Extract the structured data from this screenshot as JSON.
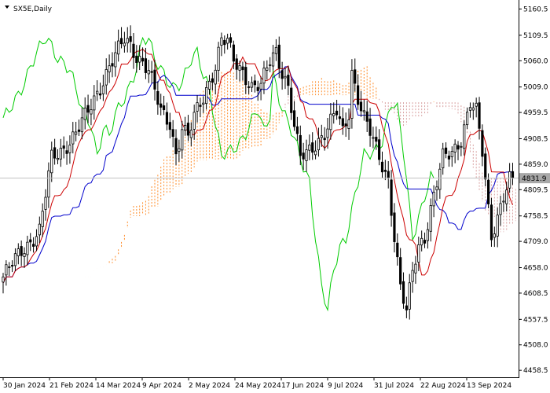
{
  "chart_data": {
    "type": "candlestick",
    "symbol_label": "SX5E,Daily",
    "current_price_label": "4831.9",
    "current_price": 4831.9,
    "ylim": [
      4445,
      5178
    ],
    "y_ticks": [
      "5160.5",
      "5109.5",
      "5060.0",
      "5009.0",
      "4959.5",
      "4908.5",
      "4859.0",
      "4809.5",
      "4758.5",
      "4709.0",
      "4658.0",
      "4608.5",
      "4557.5",
      "4508.0",
      "4458.5"
    ],
    "x_labels": [
      "30 Jan 2024",
      "21 Feb 2024",
      "14 Mar 2024",
      "9 Apr 2024",
      "2 May 2024",
      "24 May 2024",
      "17 Jun 2024",
      "9 Jul 2024",
      "31 Jul 2024",
      "22 Aug 2024",
      "13 Sep 2024"
    ],
    "grid": false,
    "colors": {
      "candle": "#000000",
      "tenkan": "#cc0000",
      "kijun": "#0000cc",
      "chikou": "#00cc00",
      "senkou_a": "#ff8c28",
      "senkou_b": "#d8a0a0",
      "price_line": "#c0c0c0"
    },
    "close_anchors": [
      [
        0,
        4640
      ],
      [
        6,
        4690
      ],
      [
        12,
        4730
      ],
      [
        16,
        4870
      ],
      [
        20,
        4890
      ],
      [
        24,
        4920
      ],
      [
        28,
        4960
      ],
      [
        32,
        5010
      ],
      [
        35,
        5050
      ],
      [
        38,
        5080
      ],
      [
        40,
        5100
      ],
      [
        42,
        5090
      ],
      [
        44,
        5070
      ],
      [
        46,
        5060
      ],
      [
        48,
        5040
      ],
      [
        50,
        5000
      ],
      [
        52,
        4960
      ],
      [
        55,
        4940
      ],
      [
        57,
        4880
      ],
      [
        59,
        4930
      ],
      [
        61,
        4910
      ],
      [
        63,
        4950
      ],
      [
        66,
        4990
      ],
      [
        70,
        5050
      ],
      [
        72,
        5100
      ],
      [
        74,
        5095
      ],
      [
        76,
        5060
      ],
      [
        79,
        5040
      ],
      [
        82,
        5010
      ],
      [
        85,
        5010
      ],
      [
        88,
        5060
      ],
      [
        90,
        5080
      ],
      [
        92,
        5040
      ],
      [
        94,
        5010
      ],
      [
        96,
        4930
      ],
      [
        98,
        4870
      ],
      [
        100,
        4880
      ],
      [
        103,
        4900
      ],
      [
        106,
        4920
      ],
      [
        108,
        4940
      ],
      [
        110,
        4960
      ],
      [
        112,
        4920
      ],
      [
        114,
        4960
      ],
      [
        115,
        5040
      ],
      [
        117,
        4990
      ],
      [
        119,
        4950
      ],
      [
        121,
        4920
      ],
      [
        124,
        4870
      ],
      [
        127,
        4830
      ],
      [
        129,
        4720
      ],
      [
        131,
        4620
      ],
      [
        133,
        4570
      ],
      [
        135,
        4650
      ],
      [
        137,
        4700
      ],
      [
        139,
        4720
      ],
      [
        142,
        4800
      ],
      [
        145,
        4870
      ],
      [
        148,
        4880
      ],
      [
        151,
        4910
      ],
      [
        154,
        4980
      ],
      [
        156,
        4960
      ],
      [
        158,
        4880
      ],
      [
        160,
        4770
      ],
      [
        161,
        4720
      ],
      [
        163,
        4760
      ],
      [
        165,
        4800
      ],
      [
        167,
        4830
      ],
      [
        168,
        4832
      ]
    ]
  }
}
